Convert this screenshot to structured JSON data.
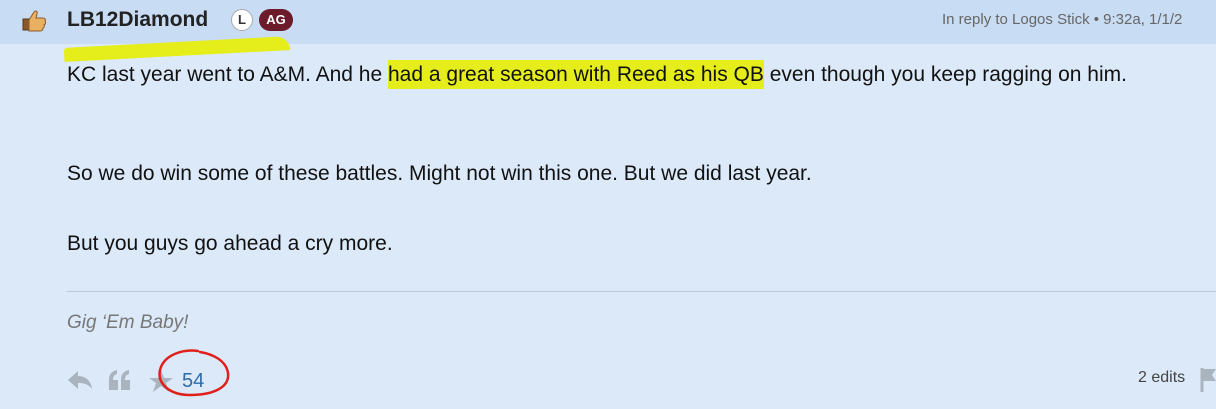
{
  "post": {
    "username": "LB12Diamond",
    "badge_l": "L",
    "badge_ag": "AG",
    "reply_info": "In reply to Logos Stick • 9:32a, 1/1/2",
    "body": {
      "p1_before": "KC last year went to A&M. And he ",
      "p1_highlight": "had a great season with Reed as his QB",
      "p1_after": " even though you keep ragging on him.",
      "p2": "So we do win some of these battles. Might not win this one. But we did last year.",
      "p3": "But you guys go ahead a cry more."
    },
    "signature": "Gig ‘Em Baby!",
    "like_count": "54",
    "edits": "2 edits"
  },
  "colors": {
    "highlight": "#e5ee1b",
    "header_bg": "#c8dcf3",
    "post_bg": "#dce9f9",
    "badge_ag": "#6b1b2a",
    "like_count": "#2e6ca8",
    "annotation_circle": "#e0201b"
  },
  "icons": [
    "thumbs-up-icon",
    "reply-icon",
    "quote-icon",
    "star-icon",
    "flag-icon"
  ]
}
